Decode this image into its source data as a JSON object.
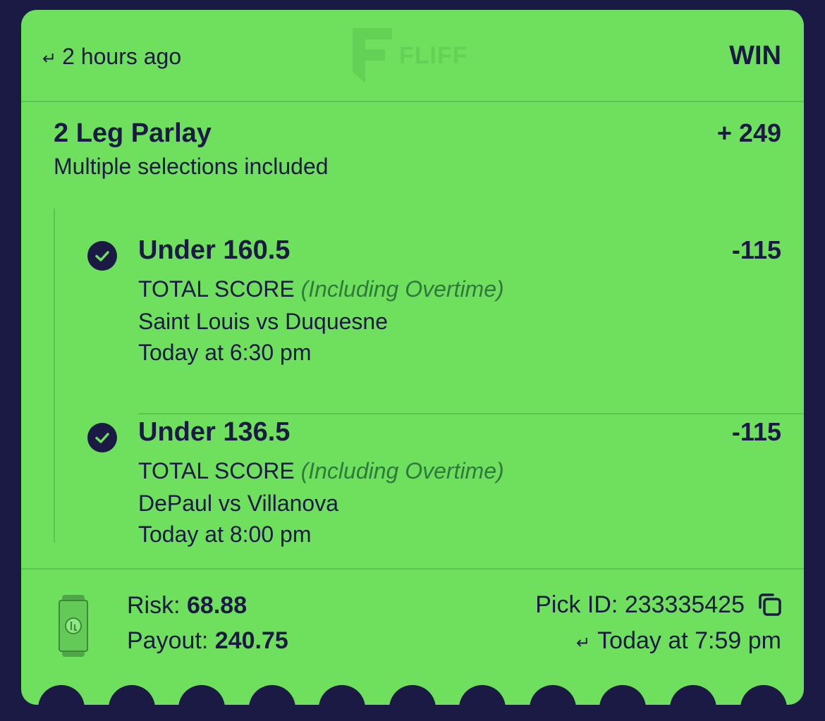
{
  "header": {
    "time_ago": "2 hours ago",
    "logo_text": "FLIFF",
    "result": "WIN"
  },
  "parlay": {
    "title": "2 Leg Parlay",
    "odds": "+ 249",
    "subtitle": "Multiple selections included"
  },
  "legs": [
    {
      "title": "Under 160.5",
      "odds": "-115",
      "market": "TOTAL SCORE",
      "market_note": "(Including Overtime)",
      "matchup": "Saint Louis vs Duquesne",
      "time": "Today at 6:30 pm",
      "status_icon": "check-circle-icon"
    },
    {
      "title": "Under 136.5",
      "odds": "-115",
      "market": "TOTAL SCORE",
      "market_note": "(Including Overtime)",
      "matchup": "DePaul vs Villanova",
      "time": "Today at 8:00 pm",
      "status_icon": "check-circle-icon"
    }
  ],
  "footer": {
    "risk_label": "Risk:",
    "risk_value": "68.88",
    "payout_label": "Payout:",
    "payout_value": "240.75",
    "pick_id_label": "Pick ID:",
    "pick_id_value": "233335425",
    "placed_time": "Today at 7:59 pm"
  },
  "colors": {
    "background": "#1a1a44",
    "ticket_green": "#6ee05e",
    "text_navy": "#1a1a44",
    "muted_green": "#2e7a3a"
  }
}
